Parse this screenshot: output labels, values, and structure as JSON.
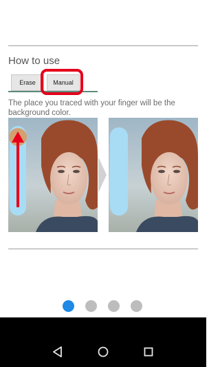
{
  "section": {
    "title": "How to use",
    "description": "The place you traced with your finger will be the background color."
  },
  "tabs": [
    {
      "label": "Erase"
    },
    {
      "label": "Manual"
    }
  ],
  "pagination": {
    "count": 4,
    "active_index": 0
  },
  "colors": {
    "accent_dot": "#1e88e5",
    "highlight_box": "#e4001b",
    "trace_stroke": "#a8dcf5",
    "arrow": "#e8001c"
  },
  "navbar": {
    "icons": [
      "back-triangle-icon",
      "home-circle-icon",
      "recents-square-icon"
    ]
  }
}
